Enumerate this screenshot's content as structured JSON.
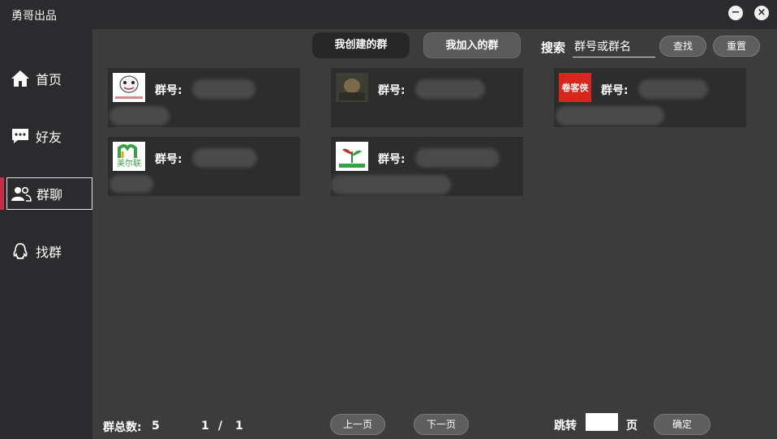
{
  "window": {
    "title": "勇哥出品",
    "minimize_label": "−",
    "close_label": "×"
  },
  "sidebar": {
    "items": [
      {
        "label": "首页",
        "icon": "home-icon"
      },
      {
        "label": "好友",
        "icon": "chat-bubble-icon"
      },
      {
        "label": "群聊",
        "icon": "group-icon",
        "active": true
      },
      {
        "label": "找群",
        "icon": "qq-penguin-icon"
      }
    ]
  },
  "tabs": {
    "created": "我创建的群",
    "joined": "我加入的群"
  },
  "search": {
    "label": "搜索",
    "placeholder": "群号或群名",
    "find_button": "查找",
    "reset_button": "重置"
  },
  "groups": [
    {
      "label": "群号:",
      "avatar_text": "",
      "avatar_desc": "meme-face"
    },
    {
      "label": "群号:",
      "avatar_text": "",
      "avatar_desc": "photo"
    },
    {
      "label": "群号:",
      "avatar_text": "卷客侠",
      "avatar_desc": "red-logo"
    },
    {
      "label": "群号:",
      "avatar_text": "美尔联",
      "avatar_desc": "green-logo"
    },
    {
      "label": "群号:",
      "avatar_text": "",
      "avatar_desc": "plant-logo"
    }
  ],
  "footer": {
    "total_label": "群总数:",
    "total_value": "5",
    "page_current": "1",
    "page_separator": "/",
    "page_total": "1",
    "prev_button": "上一页",
    "next_button": "下一页",
    "jump_label": "跳转",
    "page_unit": "页",
    "confirm_button": "确定"
  },
  "colors": {
    "accent": "#c0304a",
    "sidebar_bg": "#2b2b2d",
    "content_bg": "#3c3c3c",
    "card_bg": "#2d2d2d"
  }
}
